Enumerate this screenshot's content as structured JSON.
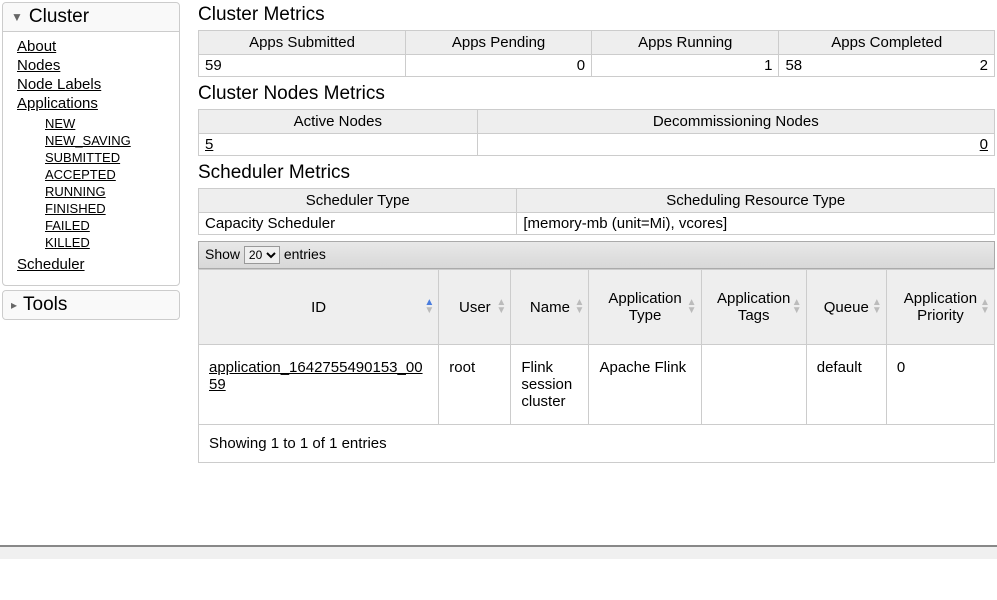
{
  "sidebar": {
    "cluster": {
      "title": "Cluster",
      "items": [
        "About",
        "Nodes",
        "Node Labels",
        "Applications"
      ],
      "sub": [
        "NEW",
        "NEW_SAVING",
        "SUBMITTED",
        "ACCEPTED",
        "RUNNING",
        "FINISHED",
        "FAILED",
        "KILLED"
      ],
      "scheduler": "Scheduler"
    },
    "tools": {
      "title": "Tools"
    }
  },
  "clusterMetrics": {
    "title": "Cluster Metrics",
    "headers": [
      "Apps Submitted",
      "Apps Pending",
      "Apps Running",
      "Apps Completed"
    ],
    "values": [
      "59",
      "0",
      "1",
      "58",
      "2"
    ]
  },
  "nodesMetrics": {
    "title": "Cluster Nodes Metrics",
    "headers": [
      "Active Nodes",
      "Decommissioning Nodes"
    ],
    "values": [
      "5",
      "0"
    ]
  },
  "schedulerMetrics": {
    "title": "Scheduler Metrics",
    "headers": [
      "Scheduler Type",
      "Scheduling Resource Type"
    ],
    "values": [
      "Capacity Scheduler",
      "[memory-mb (unit=Mi), vcores]"
    ]
  },
  "dt": {
    "showLabel": "Show",
    "entriesLabel": "entries",
    "pageSize": "20",
    "headers": [
      "ID",
      "User",
      "Name",
      "Application Type",
      "Application Tags",
      "Queue",
      "Application Priority"
    ],
    "row": {
      "id": "application_1642755490153_0059",
      "user": "root",
      "name": "Flink session cluster",
      "type": "Apache Flink",
      "tags": "",
      "queue": "default",
      "priority": "0"
    },
    "info": "Showing 1 to 1 of 1 entries"
  }
}
